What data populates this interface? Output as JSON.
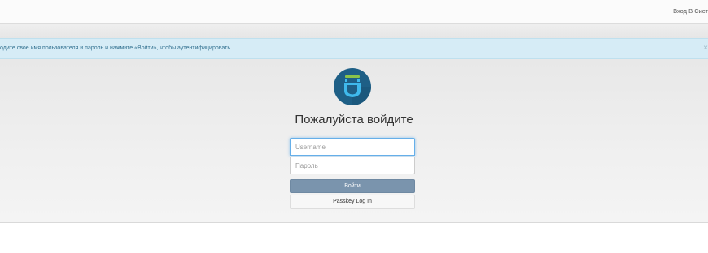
{
  "topbar": {
    "login_link": "Вход В Сист"
  },
  "alert": {
    "text": "одите свое имя пользователя и пароль и нажмите «Войти», чтобы аутентифицировать.",
    "close": "×"
  },
  "login": {
    "logo_icon": "privacyidea-shield-icon",
    "title": "Пожалуйста войдите",
    "username_placeholder": "Username",
    "password_placeholder": "Пароль",
    "submit_label": "Войти",
    "passkey_label": "Passkey Log In"
  },
  "colors": {
    "logo_bg": "#1e5f86",
    "logo_accent": "#8bc34a",
    "logo_shield": "#3fb9ec",
    "button": "#7a94ad",
    "alert_bg": "#d6ecf6"
  }
}
